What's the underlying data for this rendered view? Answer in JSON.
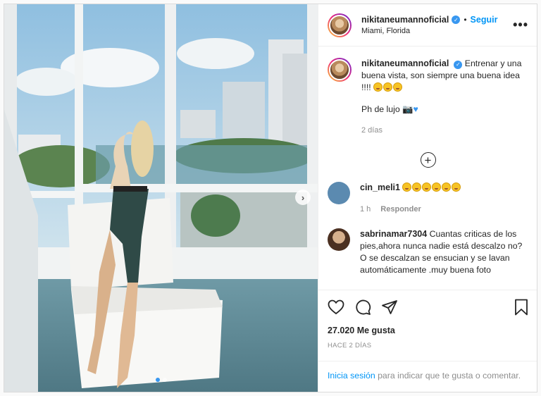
{
  "post": {
    "username": "nikitaneumannoficial",
    "follow_label": "Seguir",
    "separator": "•",
    "location": "Miami, Florida",
    "more_label": "•••",
    "carousel_count": 2,
    "carousel_active_index": 0
  },
  "caption": {
    "username": "nikitaneumannoficial",
    "text_line1": "Entrenar y una buena vista, son siempre una buena idea !!!!",
    "text_line2": "Ph de lujo",
    "time": "2 días"
  },
  "comments": [
    {
      "username": "cin_meli1",
      "text": "",
      "emoji_count": 6,
      "time": "1 h",
      "reply_label": "Responder"
    },
    {
      "username": "sabrinamar7304",
      "text": "Cuantas criticas de los pies,ahora nunca nadie está descalzo no? O se descalzan se ensucian y se lavan automáticamente .muy buena foto"
    }
  ],
  "actions": {
    "likes": "27.020 Me gusta",
    "posted": "HACE 2 DÍAS"
  },
  "login_prompt": {
    "link_label": "Inicia sesión",
    "text": " para indicar que te gusta o comentar."
  },
  "colors": {
    "accent": "#0095f6",
    "verified": "#3897f0",
    "muted": "#8e8e8e"
  },
  "icons": [
    "verified-badge-icon",
    "more-options-icon",
    "load-more-icon",
    "heart-icon",
    "comment-icon",
    "share-icon",
    "bookmark-icon",
    "chevron-right-icon"
  ]
}
